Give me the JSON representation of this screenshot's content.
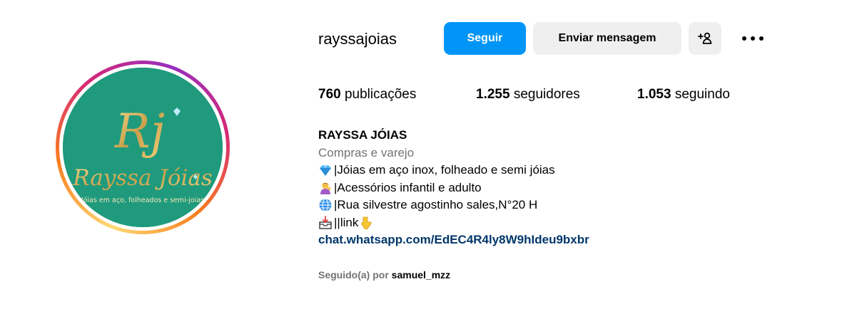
{
  "profile": {
    "username": "rayssajoias",
    "avatar_alt": "Rayssa Jóias",
    "avatar_logo": {
      "monogram": "Rj",
      "brand": "Rayssa Jóias",
      "tagline": "Jóias em aço, folheados e semi-joias",
      "bg_color": "#1f9a7d",
      "gold_color": "#d8b45a"
    }
  },
  "actions": {
    "follow_label": "Seguir",
    "message_label": "Enviar mensagem",
    "suggest_icon": "add-person-icon",
    "more_icon": "more-options-icon"
  },
  "stats": {
    "posts_count": "760",
    "posts_label": "publicações",
    "followers_count": "1.255",
    "followers_label": "seguidores",
    "following_count": "1.053",
    "following_label": "seguindo"
  },
  "bio": {
    "name": "RAYSSA JÓIAS",
    "category": "Compras e varejo",
    "lines": [
      {
        "icon": "gem-emoji",
        "text": "|Jóias em aço inox, folheado e semi jóias"
      },
      {
        "icon": "woman-tipping-hand-emoji",
        "text": "|Acessórios infantil e adulto"
      },
      {
        "icon": "globe-emoji",
        "text": "|Rua silvestre agostinho sales,N°20 H"
      },
      {
        "icon": "inbox-tray-emoji",
        "text": "||link",
        "trailing_icon": "pointing-down-emoji"
      }
    ],
    "link": "chat.whatsapp.com/EdEC4R4ly8W9hIdeu9bxbr"
  },
  "followed_by": {
    "prefix": "Seguido(a) por",
    "name": "samuel_mzz"
  },
  "colors": {
    "primary_button": "#0095f6",
    "secondary_button": "#efefef",
    "link": "#00376b",
    "muted_text": "#737373"
  }
}
